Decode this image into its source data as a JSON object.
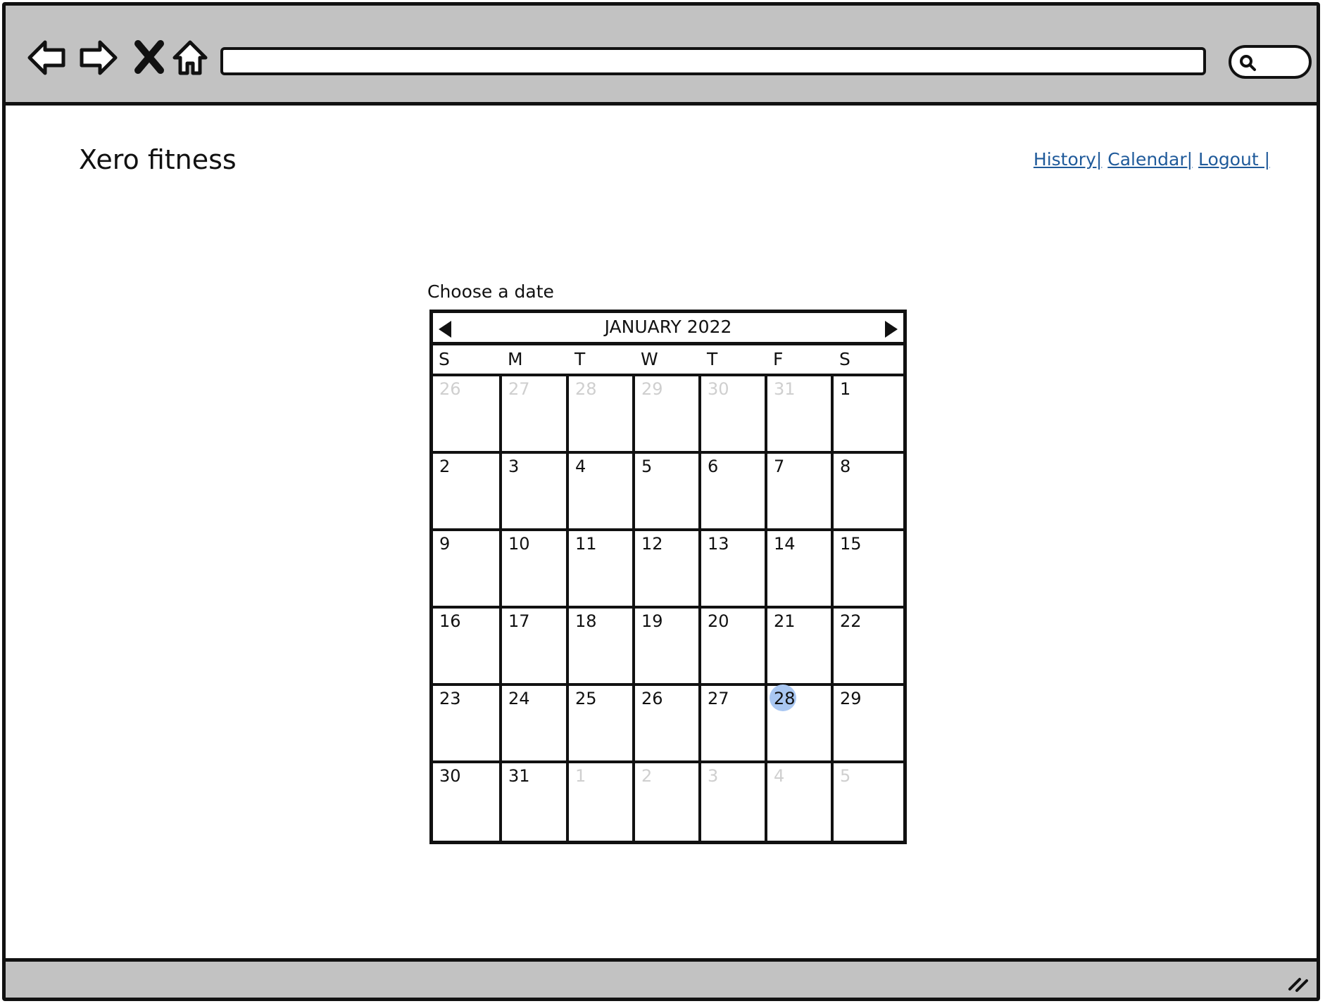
{
  "browser": {
    "icons": [
      "back-arrow-icon",
      "forward-arrow-icon",
      "close-x-icon",
      "home-icon",
      "search-icon",
      "resize-grip-icon"
    ],
    "address_value": ""
  },
  "app": {
    "brand": "Xero fitness",
    "links": [
      "History|",
      "Calendar|",
      "Logout |"
    ]
  },
  "datepicker": {
    "label": "Choose a date",
    "month_label": "JANUARY 2022",
    "weekdays": [
      "S",
      "M",
      "T",
      "W",
      "T",
      "F",
      "S"
    ],
    "weeks": [
      [
        {
          "d": "26",
          "m": true
        },
        {
          "d": "27",
          "m": true
        },
        {
          "d": "28",
          "m": true
        },
        {
          "d": "29",
          "m": true
        },
        {
          "d": "30",
          "m": true
        },
        {
          "d": "31",
          "m": true
        },
        {
          "d": "1"
        }
      ],
      [
        {
          "d": "2"
        },
        {
          "d": "3"
        },
        {
          "d": "4"
        },
        {
          "d": "5"
        },
        {
          "d": "6"
        },
        {
          "d": "7"
        },
        {
          "d": "8"
        }
      ],
      [
        {
          "d": "9"
        },
        {
          "d": "10"
        },
        {
          "d": "11"
        },
        {
          "d": "12"
        },
        {
          "d": "13"
        },
        {
          "d": "14"
        },
        {
          "d": "15"
        }
      ],
      [
        {
          "d": "16"
        },
        {
          "d": "17"
        },
        {
          "d": "18"
        },
        {
          "d": "19"
        },
        {
          "d": "20"
        },
        {
          "d": "21"
        },
        {
          "d": "22"
        }
      ],
      [
        {
          "d": "23"
        },
        {
          "d": "24"
        },
        {
          "d": "25"
        },
        {
          "d": "26"
        },
        {
          "d": "27"
        },
        {
          "d": "28",
          "sel": true
        },
        {
          "d": "29"
        }
      ],
      [
        {
          "d": "30"
        },
        {
          "d": "31"
        },
        {
          "d": "1",
          "m": true
        },
        {
          "d": "2",
          "m": true
        },
        {
          "d": "3",
          "m": true
        },
        {
          "d": "4",
          "m": true
        },
        {
          "d": "5",
          "m": true
        }
      ]
    ],
    "selected_color": "#a9c7f2",
    "muted_color": "#cfcfcf"
  },
  "colors": {
    "chrome_gray": "#c2c2c2",
    "link_blue": "#1f5a9a"
  }
}
